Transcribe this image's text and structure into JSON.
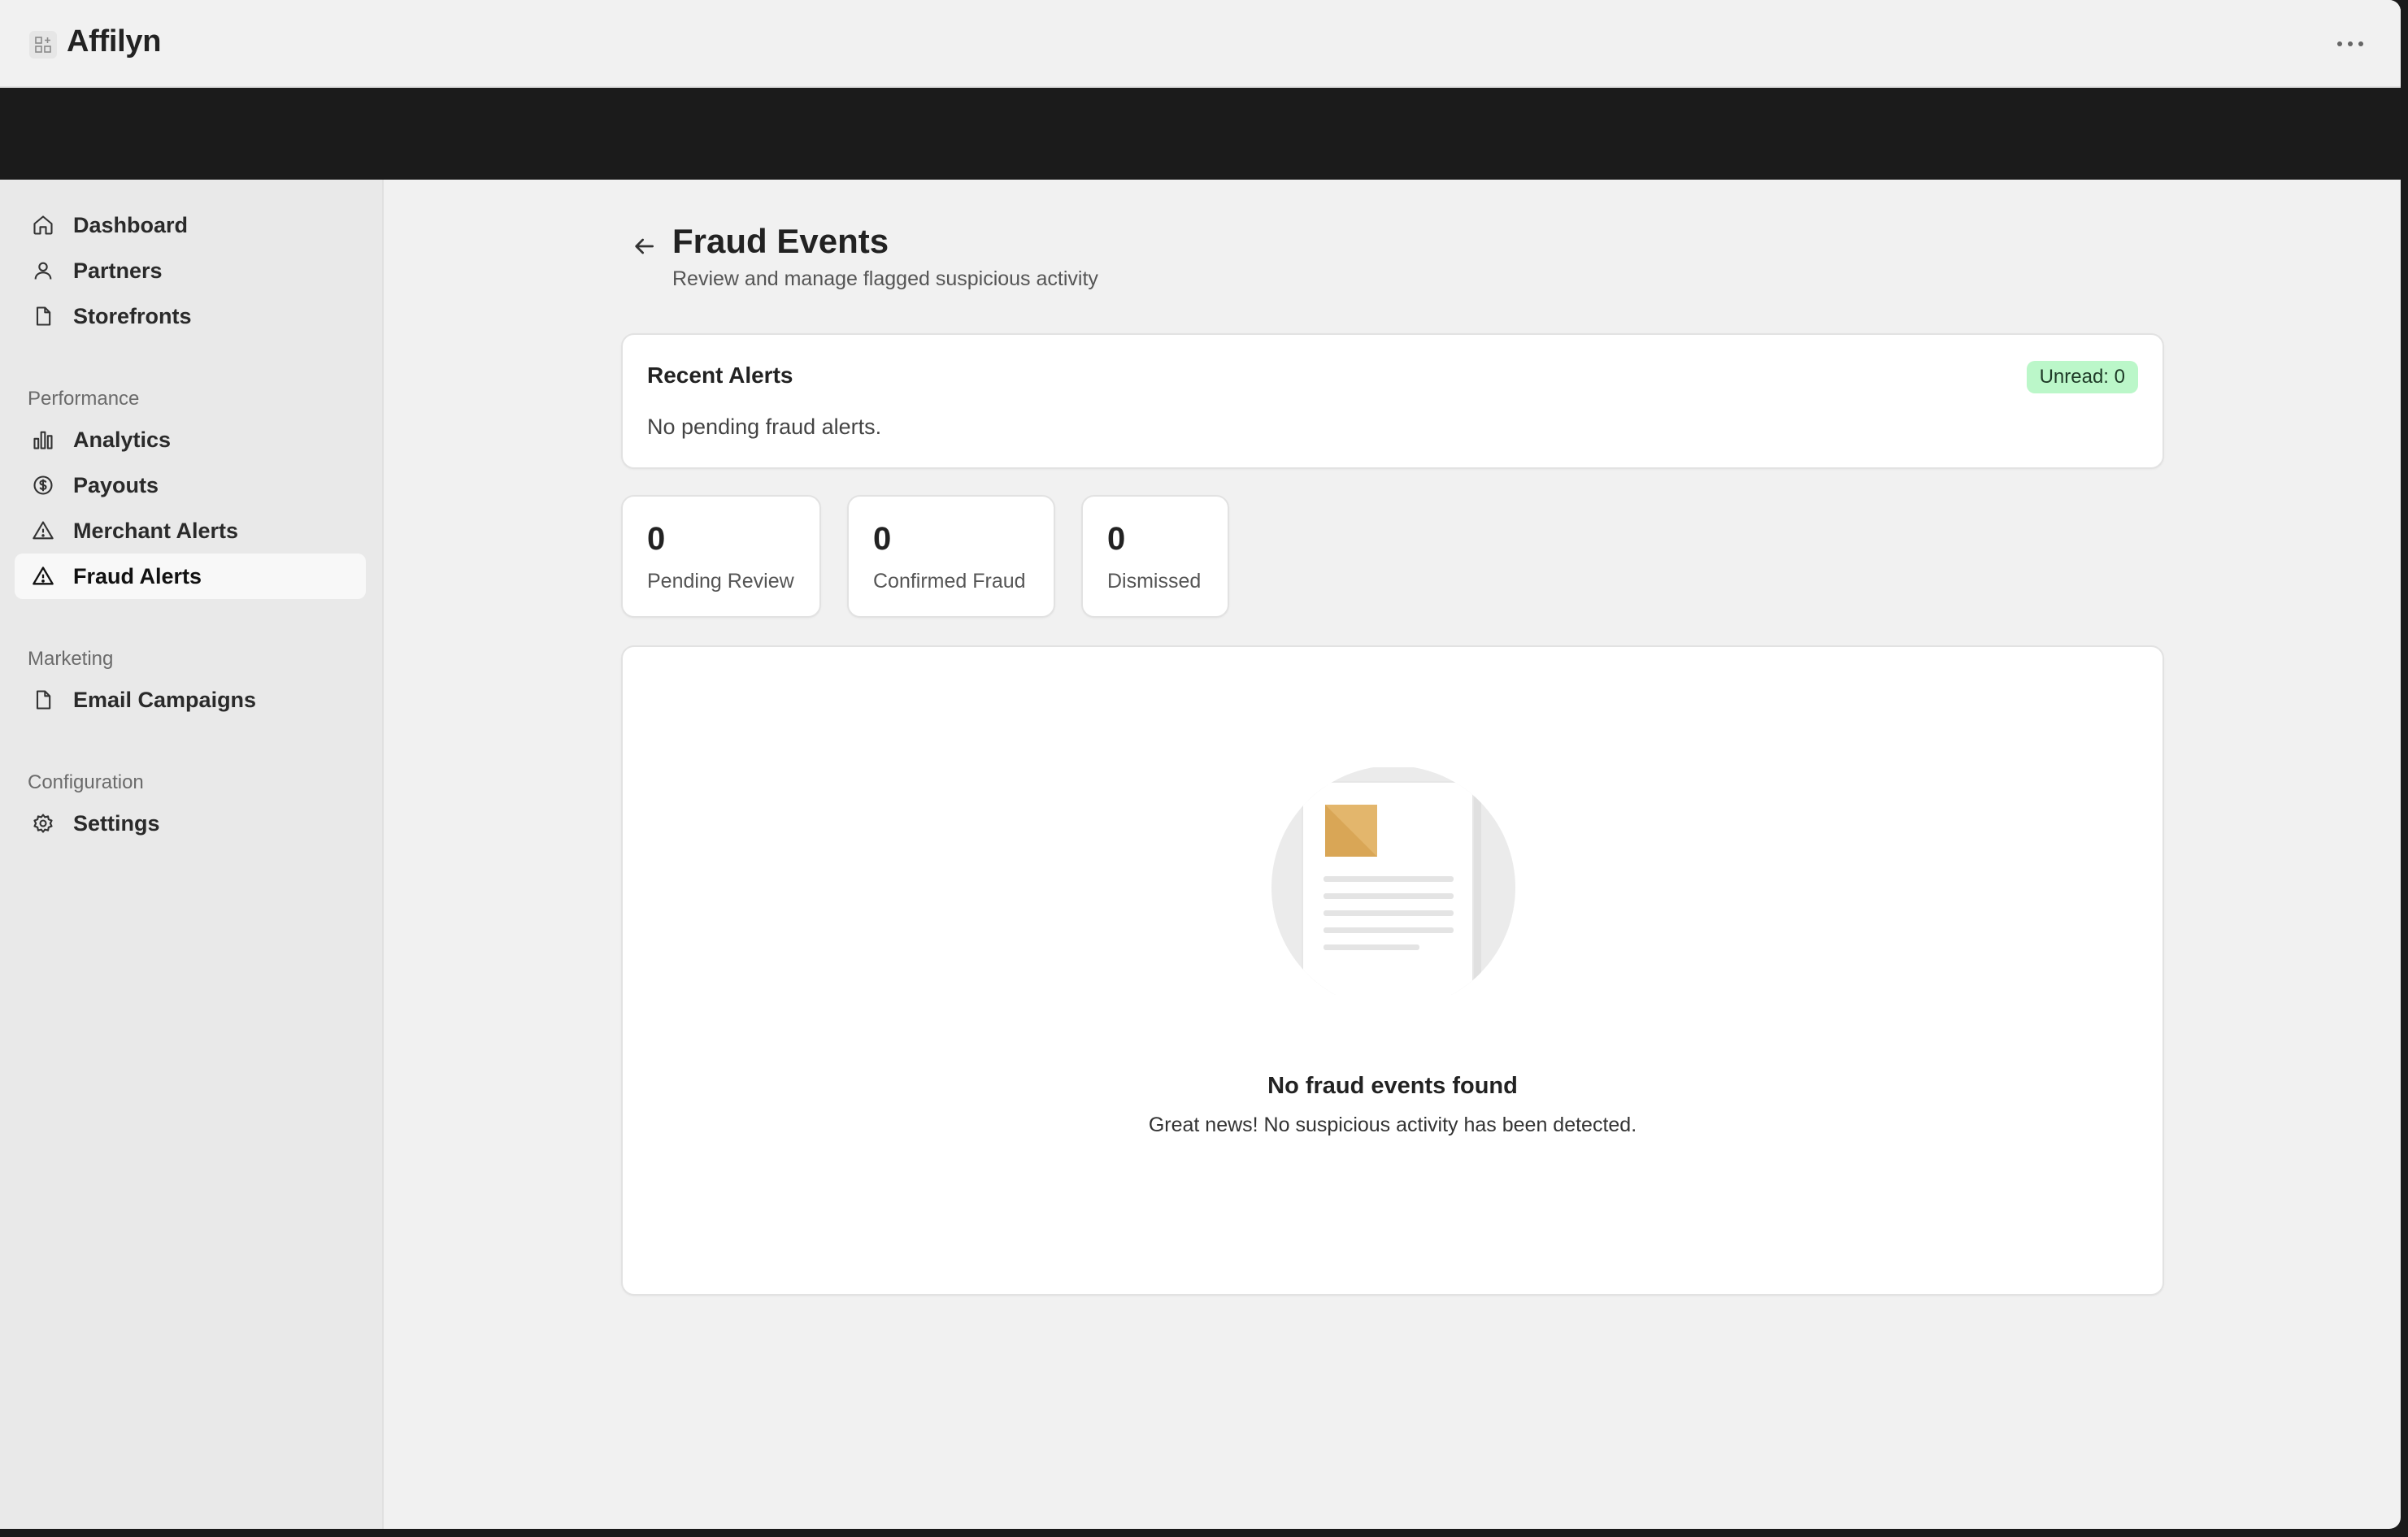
{
  "app": {
    "title": "Affilyn"
  },
  "sidebar": {
    "items": [
      {
        "label": "Dashboard",
        "icon": "home-icon"
      },
      {
        "label": "Partners",
        "icon": "user-icon"
      },
      {
        "label": "Storefronts",
        "icon": "file-icon"
      }
    ],
    "sections": [
      {
        "label": "Performance",
        "items": [
          {
            "label": "Analytics",
            "icon": "bar-chart-icon"
          },
          {
            "label": "Payouts",
            "icon": "dollar-circle-icon"
          },
          {
            "label": "Merchant Alerts",
            "icon": "warning-triangle-icon"
          },
          {
            "label": "Fraud Alerts",
            "icon": "warning-triangle-icon",
            "active": true
          }
        ]
      },
      {
        "label": "Marketing",
        "items": [
          {
            "label": "Email Campaigns",
            "icon": "file-icon"
          }
        ]
      },
      {
        "label": "Configuration",
        "items": [
          {
            "label": "Settings",
            "icon": "gear-icon"
          }
        ]
      }
    ]
  },
  "page": {
    "title": "Fraud Events",
    "subtitle": "Review and manage flagged suspicious activity"
  },
  "alerts": {
    "title": "Recent Alerts",
    "badge": "Unread: 0",
    "empty_text": "No pending fraud alerts."
  },
  "stats": [
    {
      "value": "0",
      "label": "Pending Review"
    },
    {
      "value": "0",
      "label": "Confirmed Fraud"
    },
    {
      "value": "0",
      "label": "Dismissed"
    }
  ],
  "empty_state": {
    "title": "No fraud events found",
    "description": "Great news! No suspicious activity has been detected."
  },
  "colors": {
    "badge_bg": "#bbf7c9",
    "illustration_accent": "#d9a656"
  }
}
